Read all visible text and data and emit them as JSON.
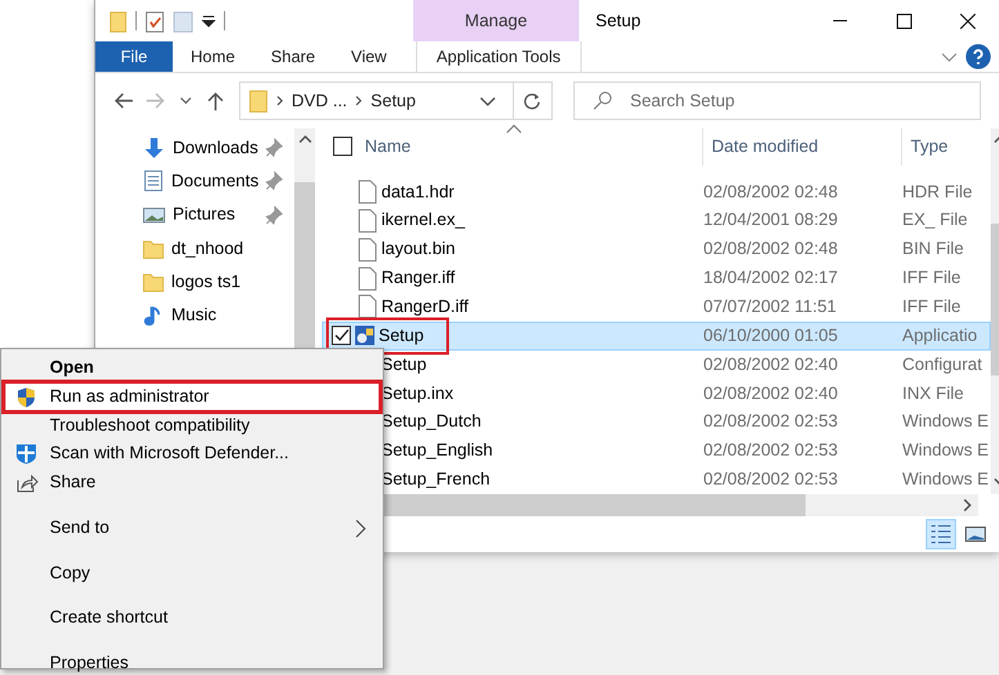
{
  "title_bar": {
    "title": "Setup",
    "context_tab": "Manage"
  },
  "ribbon_tabs": [
    {
      "label": "File",
      "kind": "file"
    },
    {
      "label": "Home",
      "kind": "tab"
    },
    {
      "label": "Share",
      "kind": "tab"
    },
    {
      "label": "View",
      "kind": "tab"
    },
    {
      "label": "Application Tools",
      "kind": "context"
    }
  ],
  "address_bar": {
    "path": [
      "DVD ...",
      "Setup"
    ]
  },
  "search": {
    "placeholder": "Search Setup"
  },
  "nav_pane": {
    "items": [
      {
        "label": "Downloads",
        "kind": "download",
        "pinned": true
      },
      {
        "label": "Documents",
        "kind": "document",
        "pinned": true
      },
      {
        "label": "Pictures",
        "kind": "pictures",
        "pinned": true
      },
      {
        "label": "dt_nhood",
        "kind": "folder",
        "pinned": false
      },
      {
        "label": "logos ts1",
        "kind": "folder",
        "pinned": false
      },
      {
        "label": "Music",
        "kind": "music",
        "pinned": false
      }
    ]
  },
  "file_list": {
    "columns": [
      "Name",
      "Date modified",
      "Type"
    ],
    "select_all": {
      "checked": false
    },
    "rows": [
      {
        "name": "data1.hdr",
        "date": "02/08/2002 02:48",
        "type": "HDR File",
        "kind": "file",
        "selected": false,
        "checked": false,
        "highlighted": false
      },
      {
        "name": "ikernel.ex_",
        "date": "12/04/2001 08:29",
        "type": "EX_ File",
        "kind": "file",
        "selected": false,
        "checked": false,
        "highlighted": false
      },
      {
        "name": "layout.bin",
        "date": "02/08/2002 02:48",
        "type": "BIN File",
        "kind": "file",
        "selected": false,
        "checked": false,
        "highlighted": false
      },
      {
        "name": "Ranger.iff",
        "date": "18/04/2002 02:17",
        "type": "IFF File",
        "kind": "file",
        "selected": false,
        "checked": false,
        "highlighted": false
      },
      {
        "name": "RangerD.iff",
        "date": "07/07/2002 11:51",
        "type": "IFF File",
        "kind": "file",
        "selected": false,
        "checked": false,
        "highlighted": false
      },
      {
        "name": "Setup",
        "date": "06/10/2000 01:05",
        "type": "Applicatio",
        "kind": "app",
        "selected": true,
        "checked": true,
        "highlighted": true
      },
      {
        "name": "Setup",
        "date": "02/08/2002 02:40",
        "type": "Configurat",
        "selected": false,
        "checked": false,
        "highlighted": false
      },
      {
        "name": "Setup.inx",
        "date": "02/08/2002 02:40",
        "type": "INX File",
        "selected": false,
        "checked": false,
        "highlighted": false
      },
      {
        "name": "Setup_Dutch",
        "date": "02/08/2002 02:53",
        "type": "Windows E",
        "selected": false,
        "checked": false,
        "highlighted": false
      },
      {
        "name": "Setup_English",
        "date": "02/08/2002 02:53",
        "type": "Windows E",
        "selected": false,
        "checked": false,
        "highlighted": false
      },
      {
        "name": "Setup_French",
        "date": "02/08/2002 02:53",
        "type": "Windows E",
        "selected": false,
        "checked": false,
        "highlighted": false
      }
    ]
  },
  "context_menu": {
    "items": [
      {
        "kind": "item",
        "label": "Open",
        "default": true,
        "highlighted": false
      },
      {
        "kind": "shield",
        "label": "Run as administrator",
        "default": false,
        "highlighted": true
      },
      {
        "kind": "item",
        "label": "Troubleshoot compatibility",
        "default": false,
        "highlighted": false
      },
      {
        "kind": "scan",
        "label": "Scan with Microsoft Defender...",
        "default": false,
        "highlighted": false
      },
      {
        "kind": "share",
        "label": "Share",
        "default": false,
        "highlighted": false
      },
      {
        "kind": "separator"
      },
      {
        "kind": "submenu",
        "label": "Send to",
        "default": false,
        "highlighted": false
      },
      {
        "kind": "separator"
      },
      {
        "kind": "item",
        "label": "Copy",
        "default": false,
        "highlighted": false
      },
      {
        "kind": "separator"
      },
      {
        "kind": "item",
        "label": "Create shortcut",
        "default": false,
        "highlighted": false
      },
      {
        "kind": "separator"
      },
      {
        "kind": "item",
        "label": "Properties",
        "default": false,
        "highlighted": false
      }
    ]
  }
}
